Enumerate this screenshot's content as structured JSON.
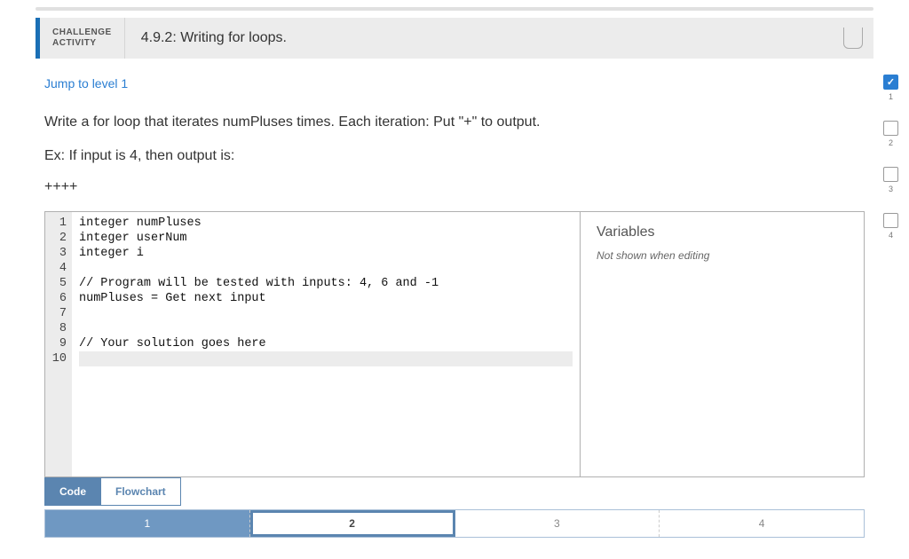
{
  "header": {
    "label_line1": "CHALLENGE",
    "label_line2": "ACTIVITY",
    "title": "4.9.2: Writing for loops."
  },
  "jump_link": "Jump to level 1",
  "prompt": {
    "line1": "Write a for loop that iterates numPluses times. Each iteration: Put \"+\" to output.",
    "line2": "Ex: If input is 4, then output is:"
  },
  "example_output": "++++",
  "code": {
    "lines": [
      "integer numPluses",
      "integer userNum",
      "integer i",
      "",
      "// Program will be tested with inputs: 4, 6 and -1",
      "numPluses = Get next input",
      "",
      "",
      "// Your solution goes here",
      ""
    ],
    "highlighted_line_index": 9
  },
  "variables": {
    "title": "Variables",
    "note": "Not shown when editing"
  },
  "tabs": {
    "code": "Code",
    "flowchart": "Flowchart",
    "active": "code"
  },
  "progress": {
    "cells": [
      "1",
      "2",
      "3",
      "4"
    ],
    "filled_index": 0,
    "current_index": 1
  },
  "levels": [
    {
      "num": "1",
      "done": true
    },
    {
      "num": "2",
      "done": false
    },
    {
      "num": "3",
      "done": false
    },
    {
      "num": "4",
      "done": false
    }
  ]
}
